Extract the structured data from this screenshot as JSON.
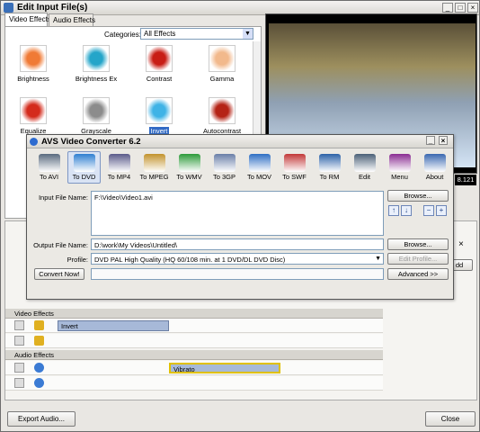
{
  "window": {
    "title": "Edit Input File(s)"
  },
  "effects_panel": {
    "tabs": [
      "Video Effects",
      "Audio Effects"
    ],
    "categories_label": "Categories:",
    "categories_value": "All Effects",
    "effects": [
      {
        "label": "Brightness",
        "color": "#f07a35"
      },
      {
        "label": "Brightness Ex",
        "color": "#24a5c9"
      },
      {
        "label": "Contrast",
        "color": "#c81d15"
      },
      {
        "label": "Gamma",
        "color": "#f2b98c"
      },
      {
        "label": "Equalize",
        "color": "#d42b1c"
      },
      {
        "label": "Grayscale",
        "color": "#8c8c8c"
      },
      {
        "label": "Invert",
        "color": "#3fb3e6"
      },
      {
        "label": "Autocontrast",
        "color": "#b52316"
      }
    ],
    "selected_effect": "Invert"
  },
  "preview": {
    "timecode": "8.121"
  },
  "timeline": {
    "video_effects_label": "Video Effects",
    "audio_effects_label": "Audio Effects",
    "video_clip": "Invert",
    "audio_clip": "Vibrato",
    "right_add_button": "dd"
  },
  "footer": {
    "export_audio": "Export Audio...",
    "close": "Close"
  },
  "avs": {
    "title": "AVS Video Converter 6.2",
    "tools": [
      {
        "label": "To AVI",
        "color": "#5a6b7f"
      },
      {
        "label": "To DVD",
        "color": "#2f7fd1"
      },
      {
        "label": "To MP4",
        "color": "#5b5b8a"
      },
      {
        "label": "To MPEG",
        "color": "#c2922c"
      },
      {
        "label": "To WMV",
        "color": "#2d9a3a"
      },
      {
        "label": "To 3GP",
        "color": "#6a7fa8"
      },
      {
        "label": "To MOV",
        "color": "#2f6fc4"
      },
      {
        "label": "To SWF",
        "color": "#c23838"
      },
      {
        "label": "To RM",
        "color": "#2c62a8"
      },
      {
        "label": "Edit",
        "color": "#4b6178"
      },
      {
        "label": "Menu",
        "color": "#8a2d92"
      },
      {
        "label": "About",
        "color": "#3a68b0"
      }
    ],
    "active_tool": "To DVD",
    "input_label": "Input File Name:",
    "input_value": "F:\\Video\\Video1.avi",
    "output_label": "Output File Name:",
    "output_value": "D:\\work\\My Videos\\Untitled\\",
    "profile_label": "Profile:",
    "profile_value": "DVD PAL High Quality (HQ 60/108 min. at 1 DVD/DL DVD Disc)",
    "browse1": "Browse...",
    "browse2": "Browse...",
    "edit_profile": "Edit Profile...",
    "advanced": "Advanced >>",
    "convert": "Convert Now!",
    "arrows": {
      "up": "↑",
      "down": "↓",
      "minus": "−",
      "plus": "+"
    }
  }
}
